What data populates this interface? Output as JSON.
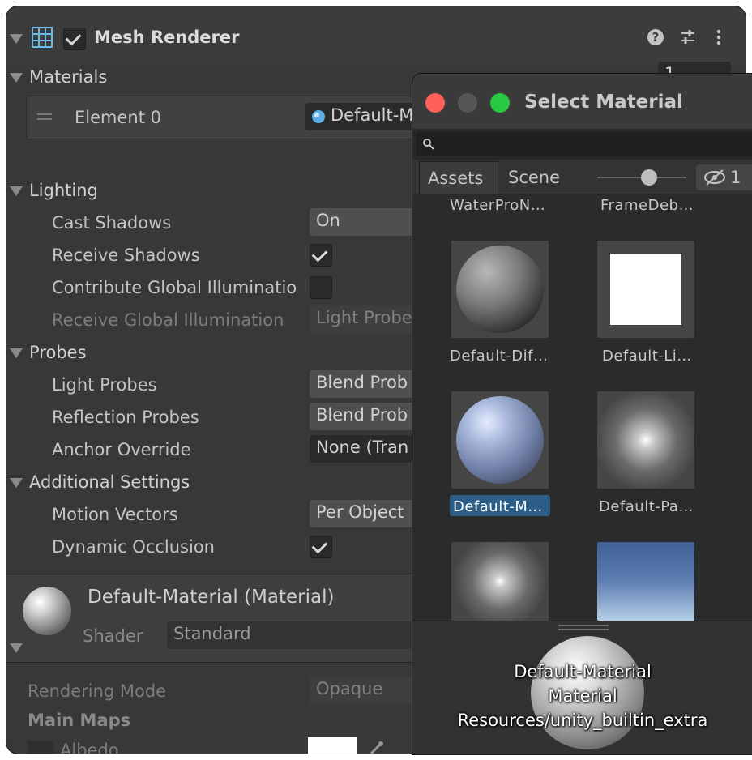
{
  "inspector": {
    "component_title": "Mesh Renderer",
    "sections": {
      "materials": "Materials",
      "materials_count": "1",
      "element_label": "Element 0",
      "element_value": "Default-M",
      "lighting": "Lighting",
      "probes": "Probes",
      "additional": "Additional Settings"
    },
    "rows": {
      "cast_shadows": {
        "label": "Cast Shadows",
        "value": "On"
      },
      "receive_shadows": {
        "label": "Receive Shadows"
      },
      "contribute_gi": {
        "label": "Contribute Global Illuminatio"
      },
      "receive_gi": {
        "label": "Receive Global Illumination",
        "value": "Light Probe"
      },
      "light_probes": {
        "label": "Light Probes",
        "value": "Blend Prob"
      },
      "reflection_probes": {
        "label": "Reflection Probes",
        "value": "Blend Prob"
      },
      "anchor_override": {
        "label": "Anchor Override",
        "value": "None (Tran"
      },
      "motion_vectors": {
        "label": "Motion Vectors",
        "value": "Per Object"
      },
      "dynamic_occlusion": {
        "label": "Dynamic Occlusion"
      }
    },
    "material_block": {
      "name": "Default-Material (Material)",
      "shader_label": "Shader",
      "shader_value": "Standard",
      "rendering_mode_label": "Rendering Mode",
      "rendering_mode_value": "Opaque",
      "main_maps": "Main Maps",
      "albedo": "Albedo"
    }
  },
  "popup": {
    "title": "Select Material",
    "tabs": [
      "Assets",
      "Scene"
    ],
    "hidden_count": "1",
    "partial_captions": [
      "WaterProN…",
      "FrameDeb…"
    ],
    "items": [
      {
        "caption": "Default-Dif…"
      },
      {
        "caption": "Default-Li…"
      },
      {
        "caption": "Default-M…",
        "selected": true
      },
      {
        "caption": "Default-Pa…"
      }
    ],
    "preview": {
      "name": "Default-Material",
      "type": "Material",
      "path": "Resources/unity_builtin_extra"
    }
  },
  "colors": {
    "window_bg": "#383838",
    "popup_bg": "#282828",
    "selection": "#2c5d87",
    "traffic_red": "#ff5f57",
    "traffic_green": "#28c840"
  },
  "icons": [
    "mesh-grid-icon",
    "help-icon",
    "preset-icon",
    "kebab-menu-icon",
    "search-icon",
    "hidden-eye-icon",
    "material-dot-icon"
  ]
}
